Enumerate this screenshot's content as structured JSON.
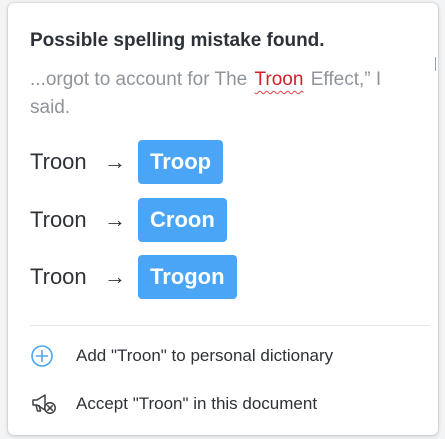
{
  "popup": {
    "title": "Possible spelling mistake found.",
    "context_before": "...orgot to account for The",
    "context_error": "Troon",
    "context_after": "Effect,” I said."
  },
  "suggestions": [
    {
      "original": "Troon",
      "arrow": "→",
      "replacement": "Troop"
    },
    {
      "original": "Troon",
      "arrow": "→",
      "replacement": "Croon"
    },
    {
      "original": "Troon",
      "arrow": "→",
      "replacement": "Trogon"
    }
  ],
  "actions": [
    {
      "label": "Add \"Troon\" to personal dictionary",
      "icon": "add-circle-icon"
    },
    {
      "label": "Accept \"Troon\" in this document",
      "icon": "megaphone-dismiss-icon"
    }
  ],
  "colors": {
    "accent": "#4ba5f7",
    "error": "#d0202a",
    "muted_text": "#8e949a",
    "text": "#2d3238"
  }
}
